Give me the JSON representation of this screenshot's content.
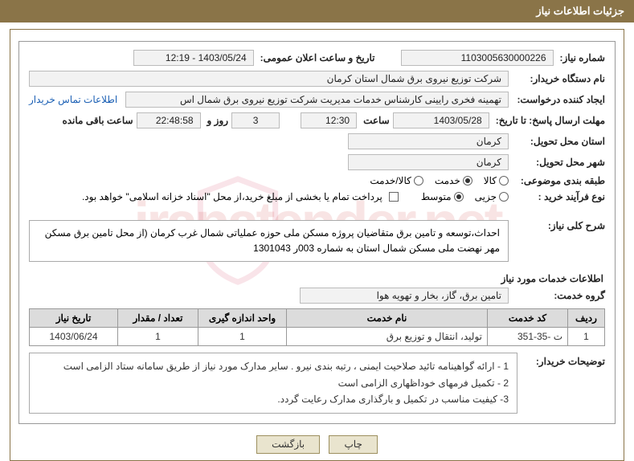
{
  "header_title": "جزئیات اطلاعات نیاز",
  "fields": {
    "need_no_label": "شماره نیاز:",
    "need_no": "1103005630000226",
    "ann_datetime_label": "تاریخ و ساعت اعلان عمومی:",
    "ann_datetime": "1403/05/24 - 12:19",
    "buyer_org_label": "نام دستگاه خریدار:",
    "buyer_org": "شرکت توزیع نیروی برق شمال استان کرمان",
    "requester_label": "ایجاد کننده درخواست:",
    "requester": "تهمینه فخری رایینی کارشناس خدمات مدیریت شرکت توزیع نیروی برق شمال اس",
    "contact_link": "اطلاعات تماس خریدار",
    "deadline_label": "مهلت ارسال پاسخ: تا تاریخ:",
    "deadline_date": "1403/05/28",
    "time_label": "ساعت",
    "deadline_time": "12:30",
    "days": "3",
    "days_label": "روز و",
    "remain_time": "22:48:58",
    "remain_label": "ساعت باقی مانده",
    "province_label": "استان محل تحویل:",
    "province": "کرمان",
    "city_label": "شهر محل تحویل:",
    "city": "کرمان",
    "subject_class_label": "طبقه بندی موضوعی:",
    "opt_kala": "کالا",
    "opt_khedmat": "خدمت",
    "opt_kalakh": "کالا/خدمت",
    "process_label": "نوع فرآیند خرید :",
    "opt_jozi": "جزیی",
    "opt_motavaset": "متوسط",
    "treasury_note": "پرداخت تمام یا بخشی از مبلغ خرید،از محل \"اسناد خزانه اسلامی\" خواهد بود.",
    "general_label": "شرح کلی نیاز:",
    "general_desc": "احداث،توسعه و تامین برق متقاضیان پروژه مسکن ملی حوزه عملیاتی شمال غرب کرمان (از محل تامین برق مسکن مهر نهضت ملی مسکن شمال استان به شماره 003ر 1301043",
    "services_info_label": "اطلاعات خدمات مورد نیاز",
    "group_label": "گروه خدمت:",
    "group_value": "تامین برق، گاز، بخار و تهویه هوا",
    "buyer_notes_label": "توضیحات خریدار:",
    "notes_line1": "1 - ارائه گواهینامه تائید صلاحیت ایمنی ، رتبه بندی نیرو  .  سایر مدارک مورد نیاز از طریق سامانه ستاد الزامی است",
    "notes_line2": "2 - تکمیل فرمهای خوداظهاری الزامی است",
    "notes_line3": "3- کیفیت مناسب در تکمیل و بارگذاری مدارک رعایت گردد.",
    "btn_print": "چاپ",
    "btn_back": "بازگشت"
  },
  "table": {
    "headers": {
      "row": "ردیف",
      "code": "کد خدمت",
      "name": "نام خدمت",
      "unit": "واحد اندازه گیری",
      "qty": "تعداد / مقدار",
      "date": "تاریخ نیاز"
    },
    "rows": [
      {
        "row": "1",
        "code": "ت -35-351",
        "name": "تولید، انتقال و توزیع برق",
        "unit": "1",
        "qty": "1",
        "date": "1403/06/24"
      }
    ]
  },
  "watermark": "iranatender.net"
}
